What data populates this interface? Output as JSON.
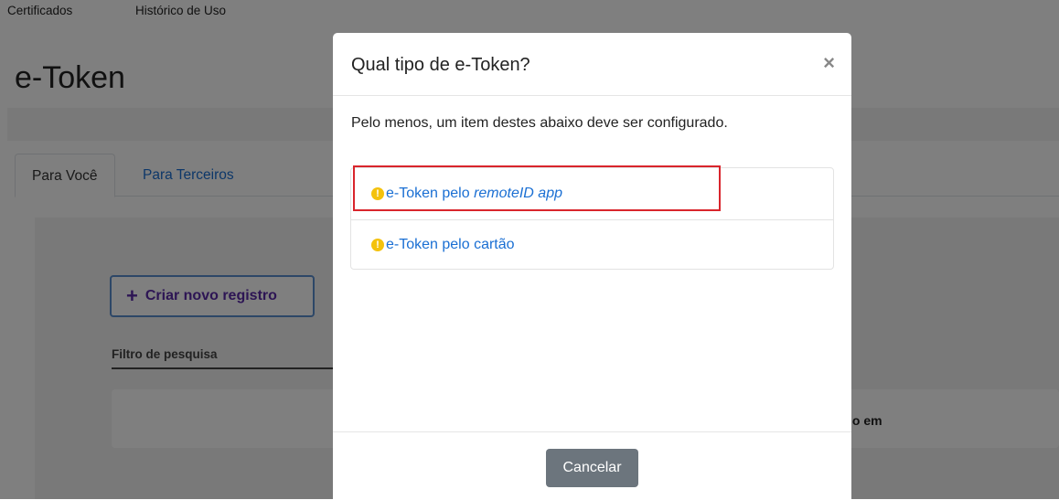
{
  "topnav": {
    "items": [
      "Certificados",
      "Histórico de Uso"
    ]
  },
  "page": {
    "title": "e-Token"
  },
  "tabs": [
    "Para Você",
    "Para Terceiros"
  ],
  "main": {
    "create_button": "Criar novo registro",
    "filter_label": "Filtro de pesquisa",
    "column_header_partial": "lo em"
  },
  "modal": {
    "title": "Qual tipo de e-Token?",
    "close": "×",
    "description": "Pelo menos, um item destes abaixo deve ser configurado.",
    "options": [
      {
        "prefix": "e-Token pelo ",
        "emphasis": "remoteID app"
      },
      {
        "prefix": "e-Token pelo cartão",
        "emphasis": ""
      }
    ],
    "cancel_label": "Cancelar"
  },
  "colors": {
    "link": "#1a6fd3",
    "warning": "#f4c20d",
    "highlight": "#d9252c",
    "cancel_bg": "#6c757d",
    "create_text": "#5a2aa8"
  },
  "icons": {
    "warning": "exclamation-circle-icon",
    "plus": "plus-icon",
    "close": "close-icon"
  }
}
